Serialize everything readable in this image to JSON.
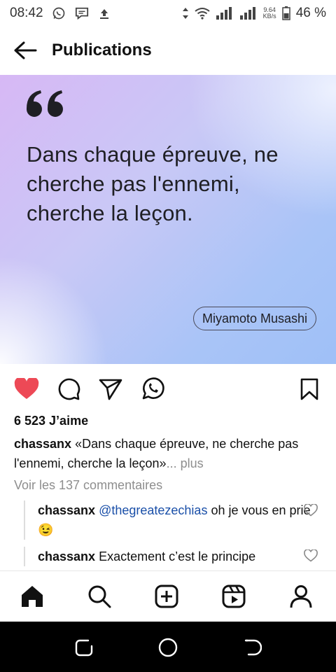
{
  "status_bar": {
    "time": "08:42",
    "net_speed_value": "9.64",
    "net_speed_unit": "KB/s",
    "battery": "46 %"
  },
  "header": {
    "title": "Publications"
  },
  "post": {
    "quote": "Dans chaque épreuve, ne cherche pas l'ennemi, cherche la leçon.",
    "author": "Miyamoto Musashi"
  },
  "engagement": {
    "likes": "6 523 J’aime",
    "caption_user": "chassanx",
    "caption_text": "«Dans chaque épreuve, ne cherche pas l'ennemi, cherche la leçon»",
    "caption_more": "... plus",
    "view_comments": "Voir les 137 commentaires",
    "liked": true
  },
  "comments": [
    {
      "user": "chassanx",
      "mention": "@thegreatezechias",
      "text": " oh je vous en prie😉"
    },
    {
      "user": "chassanx",
      "mention": "",
      "text": "Exactement c’est le principe"
    }
  ],
  "colors": {
    "heart": "#ed4956",
    "mention": "#1a4fa8",
    "muted": "#8e8e8e"
  }
}
